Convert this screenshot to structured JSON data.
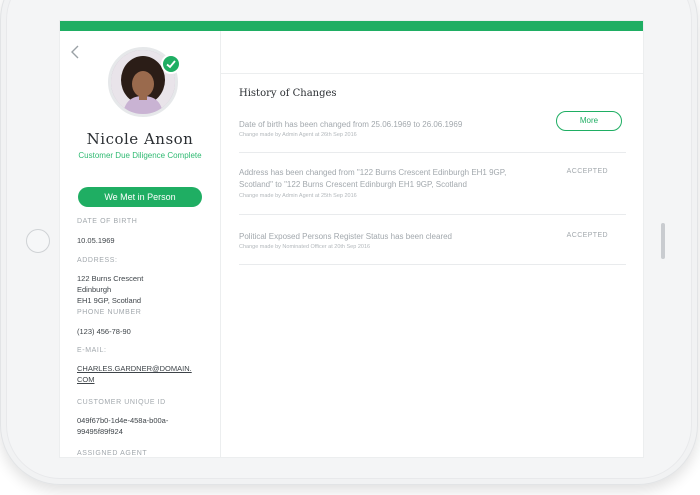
{
  "profile": {
    "name": "Nicole Anson",
    "status": "Customer Due Diligence Complete",
    "met_button": "We Met in Person"
  },
  "fields": {
    "dob_label": "DATE OF BIRTH",
    "dob_value": "10.05.1969",
    "address_label": "ADDRESS:",
    "address_line1": "122 Burns Crescent",
    "address_line2": "Edinburgh",
    "address_line3": "EH1 9GP, Scotland",
    "phone_label": "PHONE NUMBER",
    "phone_value": "(123) 456-78-90",
    "email_label": "E-MAIL:",
    "email_line1": "CHARLES.GARDNER@DOMAIN.",
    "email_line2": "COM",
    "cuid_label": "CUSTOMER UNIQUE ID",
    "cuid_line1": "049f67b0-1d4e-458a-b00a-",
    "cuid_line2": "99495f89f924",
    "agent_label": "ASSIGNED AGENT"
  },
  "history": {
    "title": "History of Changes",
    "changes": [
      {
        "text": "Date of birth has been changed from 25.06.1969 to 26.06.1969",
        "meta": "Change made by Admin Agent at 26th Sep 2016",
        "action": "More"
      },
      {
        "text_line1": "Address has been changed from \"122 Burns Crescent Edinburgh EH1 9GP,",
        "text_line2": "Scotland\" to \"122 Burns Crescent  Edinburgh EH1 9GP, Scotland",
        "meta": "Change made by Admin Agent at 25th Sep 2016",
        "status": "ACCEPTED"
      },
      {
        "text": "Political Exposed Persons Register Status has been cleared",
        "meta": "Change made by Nominated Officer at 20th Sep 2016",
        "status": "ACCEPTED"
      }
    ]
  },
  "colors": {
    "accent": "#1fae63",
    "muted_text": "#a2a8ad"
  }
}
